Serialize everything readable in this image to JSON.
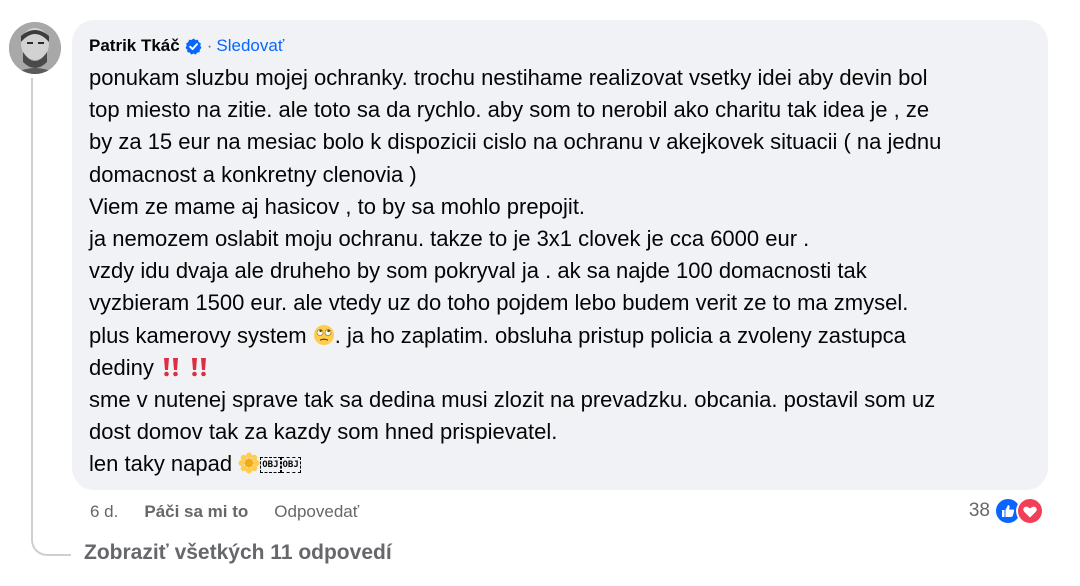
{
  "comment": {
    "author": "Patrik Tkáč",
    "separator": "·",
    "follow_label": "Sledovať",
    "lines": [
      "ponukam sluzbu mojej ochranky. trochu nestihame realizovat vsetky idei aby devin bol",
      "top miesto na zitie. ale toto sa da rychlo. aby som to nerobil ako charitu tak idea je , ze",
      "by za 15 eur na mesiac bolo k dispozicii cislo na ochranu v akejkovek situacii ( na jednu",
      "domacnost a konkretny clenovia )",
      "Viem ze mame aj hasicov , to by sa mohlo prepojit.",
      "ja nemozem oslabit moju ochranu. takze to je 3x1 clovek je cca 6000 eur .",
      "vzdy idu dvaja ale druheho by som pokryval ja . ak sa najde 100 domacnosti tak",
      "vyzbieram 1500 eur. ale vtedy uz do toho pojdem lebo budem verit ze to ma zmysel."
    ],
    "line_camera_before": "plus kamerovy system",
    "line_camera_after": ". ja ho zaplatim. obsluha pristup policia a zvoleny zastupca",
    "line_dediny": "dediny",
    "line_after_1": "sme v nutenej sprave tak sa dedina musi zlozit na prevadzku. obcania. postavil som uz",
    "line_after_2": "dost domov tak za kazdy som hned prispievatel.",
    "line_last": "len taky napad",
    "obj_1": "OBJ",
    "obj_2": "OBJ"
  },
  "actions": {
    "time": "6 d.",
    "like_label": "Páči sa mi to",
    "reply_label": "Odpovedať"
  },
  "reactions": {
    "count": "38",
    "icons": [
      "like-icon",
      "love-icon"
    ],
    "like_color": "#0866ff",
    "love_color": "#f33e58"
  },
  "view_replies_label": "Zobraziť všetkých 11 odpovedí",
  "colors": {
    "bubble": "#f0f2f5",
    "link": "#0866ff",
    "secondary": "#65676b"
  }
}
